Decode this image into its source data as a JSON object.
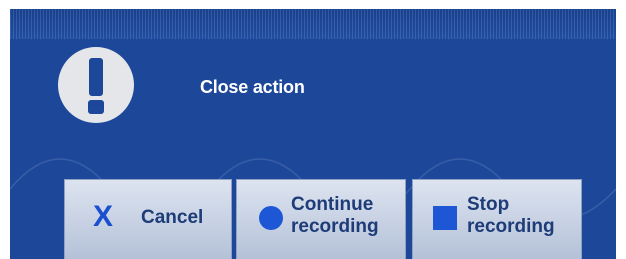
{
  "dialog": {
    "title": "Close action",
    "icon": "exclamation-icon"
  },
  "buttons": {
    "cancel": {
      "icon": "x-icon",
      "label": "Cancel"
    },
    "continue": {
      "icon": "record-circle-icon",
      "label": "Continue recording"
    },
    "stop": {
      "icon": "stop-square-icon",
      "label": "Stop recording"
    }
  },
  "colors": {
    "background": "#1d489a",
    "icon_accent": "#1e57d6",
    "button_text": "#1e3c78"
  }
}
